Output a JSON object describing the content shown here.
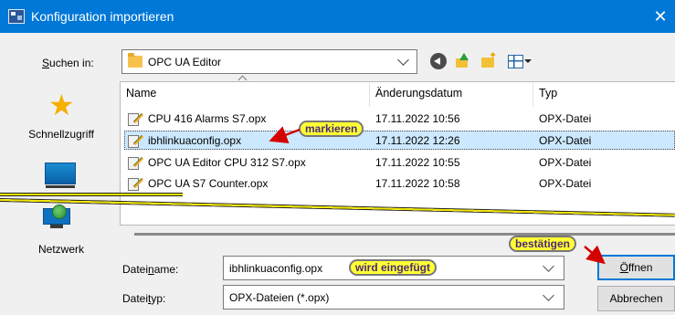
{
  "window": {
    "title": "Konfiguration importieren",
    "close_glyph": "✕"
  },
  "lookin": {
    "label_u": "S",
    "label_rest": "uchen in:",
    "value": "OPC UA Editor"
  },
  "places": [
    {
      "label": "Schnellzugriff",
      "icon": "star-icon"
    },
    {
      "label": "",
      "icon": "desktop-icon"
    },
    {
      "label": "Netzwerk",
      "icon": "network-icon"
    }
  ],
  "columns": {
    "name": "Name",
    "date": "Änderungsdatum",
    "type": "Typ"
  },
  "files": [
    {
      "name": "CPU 416 Alarms S7.opx",
      "date": "17.11.2022 10:56",
      "type": "OPX-Datei",
      "selected": false
    },
    {
      "name": "ibhlinkuaconfig.opx",
      "date": "17.11.2022 12:26",
      "type": "OPX-Datei",
      "selected": true
    },
    {
      "name": "OPC UA Editor CPU 312 S7.opx",
      "date": "17.11.2022 10:55",
      "type": "OPX-Datei",
      "selected": false
    },
    {
      "name": "OPC UA S7 Counter.opx",
      "date": "17.11.2022 10:58",
      "type": "OPX-Datei",
      "selected": false
    }
  ],
  "form": {
    "filename_label_a": "Datei",
    "filename_label_u": "n",
    "filename_label_b": "ame:",
    "filename_value": "ibhlinkuaconfig.opx",
    "filetype_label_a": "Datei",
    "filetype_label_u": "t",
    "filetype_label_b": "yp:",
    "filetype_value": "OPX-Dateien (*.opx)",
    "open_u": "Ö",
    "open_rest": "ffnen",
    "cancel": "Abbrechen"
  },
  "annotations": {
    "mark": "markieren",
    "inserted": "wird eingefügt",
    "confirm": "bestätigen"
  },
  "colors": {
    "titlebar": "#0078d7",
    "selection": "#cce8ff",
    "callout": "#ffff33",
    "arrow": "#d40000"
  }
}
